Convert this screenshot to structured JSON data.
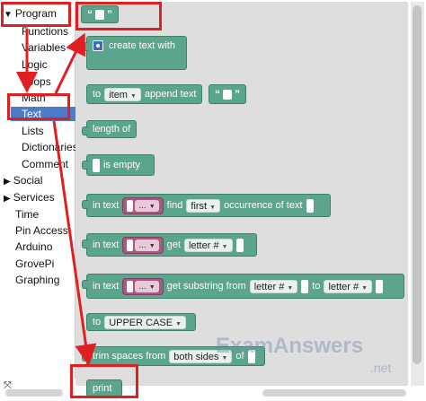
{
  "sidebar": {
    "items": [
      {
        "label": "Program",
        "expanded": true
      },
      {
        "label": "Functions"
      },
      {
        "label": "Variables"
      },
      {
        "label": "Logic"
      },
      {
        "label": "Loops"
      },
      {
        "label": "Math"
      },
      {
        "label": "Text",
        "selected": true
      },
      {
        "label": "Lists"
      },
      {
        "label": "Dictionaries"
      },
      {
        "label": "Comment"
      },
      {
        "label": "Social",
        "collapsed": true
      },
      {
        "label": "Services",
        "collapsed": true
      },
      {
        "label": "Time"
      },
      {
        "label": "Pin Access"
      },
      {
        "label": "Arduino"
      },
      {
        "label": "GrovePi"
      },
      {
        "label": "Graphing"
      }
    ]
  },
  "blocks": {
    "text_literal": {
      "open_quote": "“",
      "close_quote": "”"
    },
    "create_text": {
      "label": "create text with"
    },
    "append": {
      "to": "to",
      "var": "item",
      "label": "append text",
      "open_quote": "“",
      "close_quote": "”"
    },
    "length": {
      "label": "length of"
    },
    "is_empty": {
      "label": "is empty"
    },
    "find": {
      "in_text": "in text",
      "var": "...",
      "find": "find",
      "which": "first",
      "label": "occurrence of text"
    },
    "get_letter": {
      "in_text": "in text",
      "var": "...",
      "get": "get",
      "which": "letter #"
    },
    "substring": {
      "in_text": "in text",
      "var": "...",
      "label": "get substring from",
      "from": "letter #",
      "to": "to",
      "to_which": "letter #"
    },
    "case": {
      "to": "to",
      "which": "UPPER CASE"
    },
    "trim": {
      "label": "trim spaces from",
      "which": "both sides",
      "of": "of"
    },
    "print": {
      "label": "print"
    }
  },
  "watermark": {
    "text": "ExamAnswers",
    "sub": ".net"
  },
  "colors": {
    "block": "#5ba58c",
    "selected": "#4e7ac7",
    "annotation": "#e02020",
    "variable": "#a55b80"
  },
  "icons": {
    "expand": "triangle-down",
    "collapse": "triangle-right",
    "resize": "resize-arrows-icon"
  }
}
